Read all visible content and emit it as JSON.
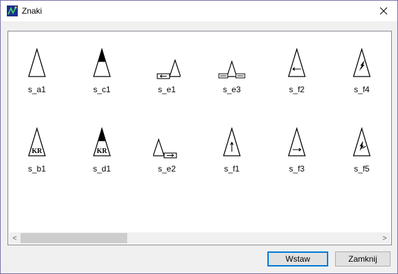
{
  "window": {
    "title": "Znaki",
    "close_glyph": "✕"
  },
  "items_row1": [
    {
      "label": "s_a1",
      "icon": "s_a1-icon"
    },
    {
      "label": "s_c1",
      "icon": "s_c1-icon"
    },
    {
      "label": "s_e1",
      "icon": "s_e1-icon"
    },
    {
      "label": "s_e3",
      "icon": "s_e3-icon"
    },
    {
      "label": "s_f2",
      "icon": "s_f2-icon"
    },
    {
      "label": "s_f4",
      "icon": "s_f4-icon"
    }
  ],
  "items_row2": [
    {
      "label": "s_b1",
      "icon": "s_b1-icon",
      "mark": "KR"
    },
    {
      "label": "s_d1",
      "icon": "s_d1-icon",
      "mark": "KR"
    },
    {
      "label": "s_e2",
      "icon": "s_e2-icon"
    },
    {
      "label": "s_f1",
      "icon": "s_f1-icon"
    },
    {
      "label": "s_f3",
      "icon": "s_f3-icon"
    },
    {
      "label": "s_f5",
      "icon": "s_f5-icon"
    }
  ],
  "scrollbar": {
    "left_arrow": "<",
    "right_arrow": ">"
  },
  "buttons": {
    "insert": "Wstaw",
    "close": "Zamknij"
  },
  "colors": {
    "accent": "#0078d7",
    "border": "#7a70a8",
    "app_icon": "#1b2f8f"
  }
}
